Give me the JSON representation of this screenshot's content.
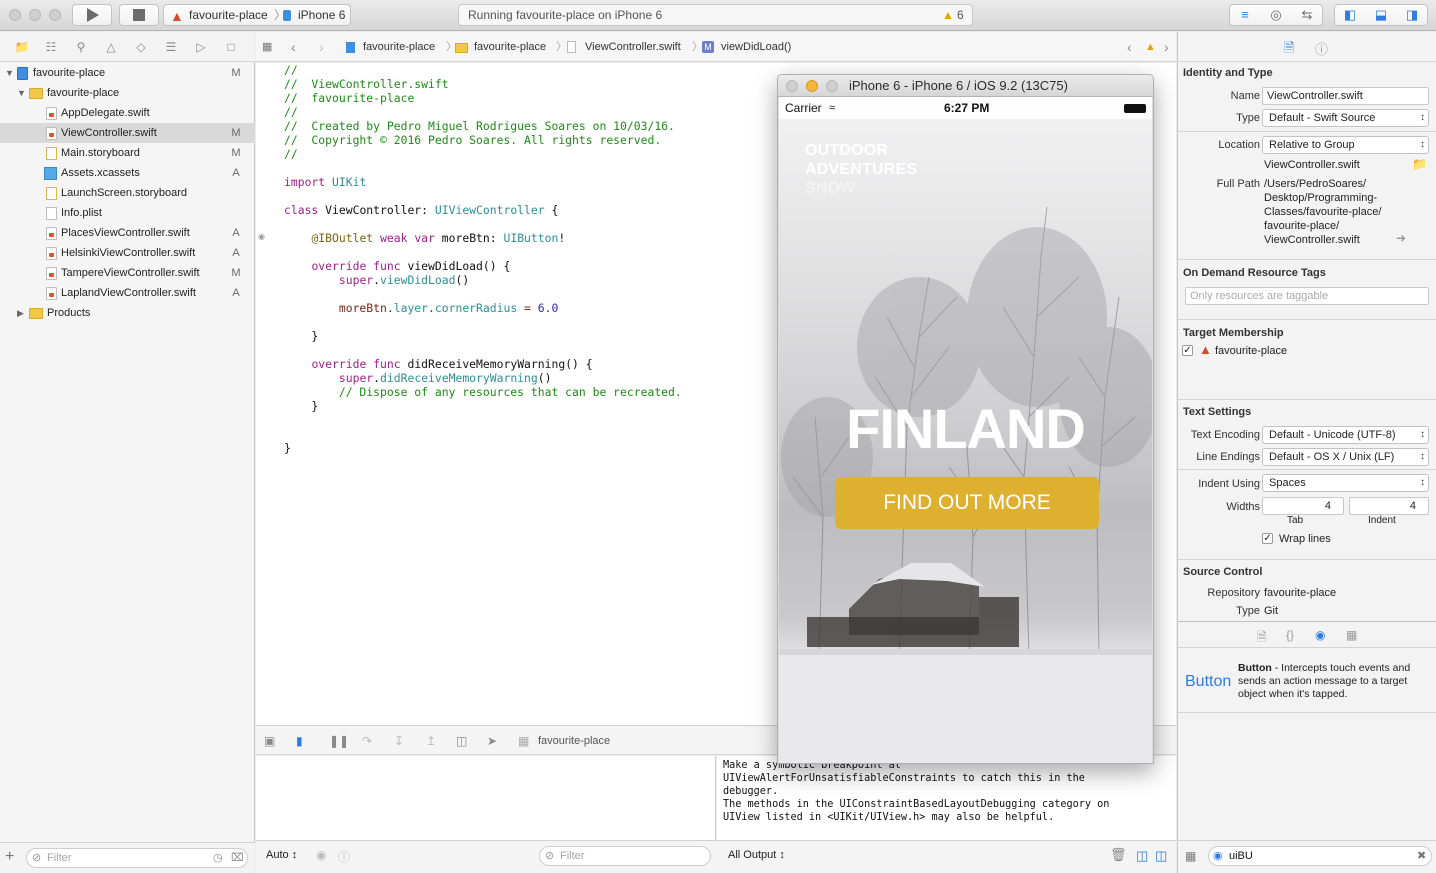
{
  "toolbar": {
    "scheme_target": "favourite-place",
    "scheme_device": "iPhone 6",
    "activity_text": "Running favourite-place on iPhone 6",
    "warning_count": "6"
  },
  "navigator": {
    "items": [
      {
        "label": "favourite-place",
        "status": "M"
      },
      {
        "label": "favourite-place",
        "status": ""
      },
      {
        "label": "AppDelegate.swift",
        "status": ""
      },
      {
        "label": "ViewController.swift",
        "status": "M"
      },
      {
        "label": "Main.storyboard",
        "status": "M"
      },
      {
        "label": "Assets.xcassets",
        "status": "A"
      },
      {
        "label": "LaunchScreen.storyboard",
        "status": ""
      },
      {
        "label": "Info.plist",
        "status": ""
      },
      {
        "label": "PlacesViewController.swift",
        "status": "A"
      },
      {
        "label": "HelsinkiViewController.swift",
        "status": "A"
      },
      {
        "label": "TampereViewController.swift",
        "status": "M"
      },
      {
        "label": "LaplandViewController.swift",
        "status": "A"
      },
      {
        "label": "Products",
        "status": ""
      }
    ],
    "filter_placeholder": "Filter"
  },
  "jumpbar": {
    "crumbs": [
      "favourite-place",
      "favourite-place",
      "ViewController.swift",
      "viewDidLoad()"
    ]
  },
  "code": {
    "lines": [
      "//",
      "//  ViewController.swift",
      "//  favourite-place",
      "//",
      "//  Created by Pedro Miguel Rodrigues Soares on 10/03/16.",
      "//  Copyright © 2016 Pedro Soares. All rights reserved.",
      "//",
      "",
      "import UIKit",
      "",
      "class ViewController: UIViewController {",
      "",
      "    @IBOutlet weak var moreBtn: UIButton!",
      "",
      "    override func viewDidLoad() {",
      "        super.viewDidLoad()",
      "",
      "        moreBtn.layer.cornerRadius = 6.0",
      "",
      "    }",
      "",
      "    override func didReceiveMemoryWarning() {",
      "        super.didReceiveMemoryWarning()",
      "        // Dispose of any resources that can be recreated.",
      "    }",
      "",
      "",
      "}"
    ]
  },
  "debug": {
    "target": "favourite-place",
    "console_text": "Make a symbolic breakpoint at\nUIViewAlertForUnsatisfiableConstraints to catch this in the\ndebugger.\nThe methods in the UIConstraintBasedLayoutDebugging category on\nUIView listed in <UIKit/UIView.h> may also be helpful.",
    "vars_mode": "Auto",
    "filter_placeholder": "Filter",
    "output_mode": "All Output"
  },
  "simulator": {
    "title": "iPhone 6 - iPhone 6 / iOS 9.2 (13C75)",
    "carrier": "Carrier",
    "time": "6:27 PM",
    "tagline_1": "OUTDOOR",
    "tagline_2": "ADVENTURES",
    "tagline_3": "SNOW",
    "headline": "FINLAND",
    "button_label": "FIND OUT MORE"
  },
  "inspector": {
    "identity_title": "Identity and Type",
    "name_label": "Name",
    "name_value": "ViewController.swift",
    "type_label": "Type",
    "type_value": "Default - Swift Source",
    "location_label": "Location",
    "location_value": "Relative to Group",
    "location_file": "ViewController.swift",
    "fullpath_label": "Full Path",
    "fullpath_lines": [
      "/Users/PedroSoares/",
      "Desktop/Programming-",
      "Classes/favourite-place/",
      "favourite-place/",
      "ViewController.swift"
    ],
    "odr_title": "On Demand Resource Tags",
    "odr_placeholder": "Only resources are taggable",
    "target_title": "Target Membership",
    "target_name": "favourite-place",
    "text_title": "Text Settings",
    "encoding_label": "Text Encoding",
    "encoding_value": "Default - Unicode (UTF-8)",
    "endings_label": "Line Endings",
    "endings_value": "Default - OS X / Unix (LF)",
    "indent_label": "Indent Using",
    "indent_value": "Spaces",
    "widths_label": "Widths",
    "tab_value": "4",
    "indent_width_value": "4",
    "tab_caption": "Tab",
    "indent_caption": "Indent",
    "wrap_label": "Wrap lines",
    "sc_title": "Source Control",
    "repo_label": "Repository",
    "repo_value": "favourite-place",
    "sctype_label": "Type",
    "sctype_value": "Git",
    "library_item_title": "Button",
    "library_item_name": "Button",
    "library_item_desc": " - Intercepts touch events and sends an action message to a target object when it's tapped.",
    "search_value": "uiBU"
  },
  "colors": {
    "accent": "#2f7de1",
    "button_yellow": "#ddb030",
    "comment_green": "#1f8a17",
    "keyword_purple": "#a01f8c"
  }
}
